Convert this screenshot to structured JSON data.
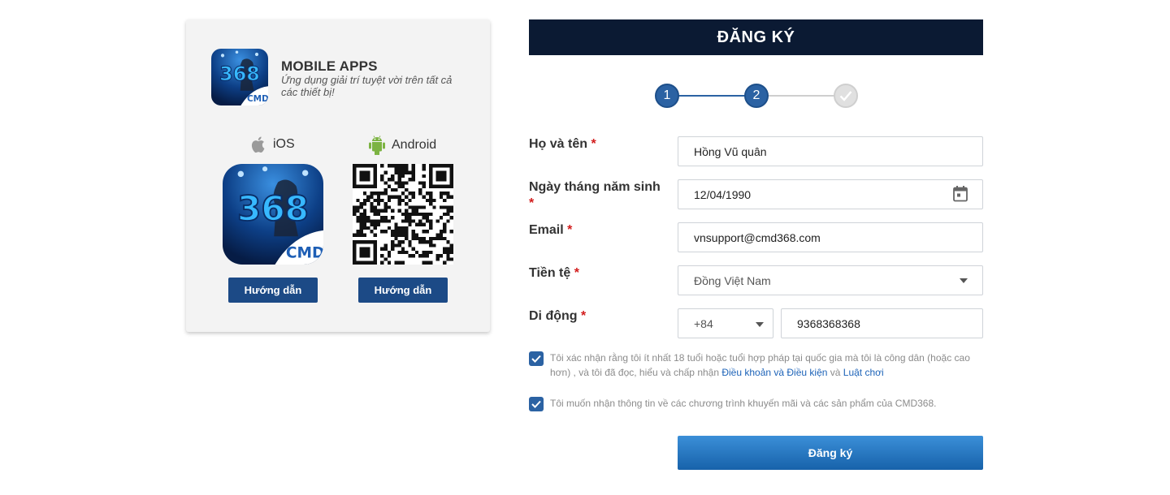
{
  "apps_card": {
    "title": "MOBILE APPS",
    "subtitle": "Ứng dụng giải trí tuyệt vời trên tất cả các thiết bị!",
    "app_icon": {
      "number": "368",
      "brand": "CMD"
    },
    "ios_label": "iOS",
    "android_label": "Android",
    "ios_guide_label": "Hướng dẫn",
    "android_guide_label": "Hướng dẫn",
    "icons": [
      "apple-icon",
      "android-icon",
      "qr-code"
    ]
  },
  "form": {
    "header": "ĐĂNG KÝ",
    "steps": [
      {
        "label": "1",
        "state": "active"
      },
      {
        "label": "2",
        "state": "active"
      },
      {
        "label": "",
        "state": "pending",
        "icon": "checkmark-icon"
      }
    ],
    "required_mark": "*",
    "fullname": {
      "label": "Họ và tên",
      "value": "Hồng Vũ quân"
    },
    "dob": {
      "label": "Ngày tháng năm sinh",
      "value": "12/04/1990",
      "icon": "calendar-icon"
    },
    "email": {
      "label": "Email",
      "value": "vnsupport@cmd368.com"
    },
    "currency": {
      "label": "Tiền tệ",
      "value": "Đồng Việt Nam"
    },
    "mobile": {
      "label": "Di động",
      "country_code": "+84",
      "number": "9368368368"
    },
    "terms": {
      "checked": true,
      "text_before": "Tôi xác nhận rằng tôi ít nhất 18 tuổi hoặc tuổi hợp pháp tại quốc gia mà tôi là công dân (hoặc cao hơn) , và tôi đã đọc, hiểu và chấp nhận ",
      "link1": "Điều khoản và Điều kiện",
      "text_between": " và ",
      "link2": "Luật chơi"
    },
    "promo": {
      "checked": true,
      "text": "Tôi muốn nhận thông tin về các chương trình khuyến mãi và các sản phẩm của CMD368."
    },
    "submit_label": "Đăng ký"
  },
  "colors": {
    "header_bg": "#0b1a33",
    "accent": "#2b62a3",
    "guide_button": "#1c4a86",
    "required": "#d21c1c",
    "link": "#1d63b8"
  }
}
